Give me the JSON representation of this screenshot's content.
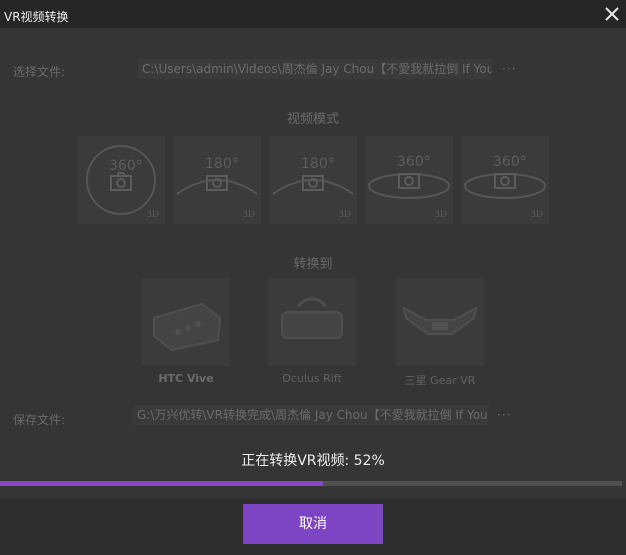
{
  "window": {
    "title": "VR视频转换"
  },
  "source": {
    "label": "选择文件:",
    "path": "C:\\Users\\admin\\Videos\\周杰倫 Jay Chou【不愛我就拉倒 If You D",
    "browse": "···"
  },
  "mode_section": {
    "title": "视频模式",
    "modes": [
      {
        "name": "360-full-3d",
        "degree": "360°",
        "tag": "3D"
      },
      {
        "name": "180-3d",
        "degree": "180°",
        "tag": "3D"
      },
      {
        "name": "180-3d-b",
        "degree": "180°",
        "tag": "3D"
      },
      {
        "name": "360-3d",
        "degree": "360°",
        "tag": "3D"
      },
      {
        "name": "360-3d-b",
        "degree": "360°",
        "tag": "3D"
      }
    ]
  },
  "convert_section": {
    "title": "转换到",
    "devices": [
      {
        "label": "HTC Vive",
        "icon": "htc-vive-headset-icon"
      },
      {
        "label": "Oculus Rift",
        "icon": "oculus-rift-headset-icon"
      },
      {
        "label": "三星 Gear VR",
        "icon": "gear-vr-headset-icon"
      }
    ]
  },
  "output": {
    "label": "保存文件:",
    "path": "G:\\万兴优转\\VR转换完成\\周杰倫 Jay Chou【不愛我就拉倒 If You",
    "browse": "···"
  },
  "progress": {
    "status": "正在转换VR视频: 52%",
    "value": 0.52
  },
  "footer": {
    "cancel_label": "取消"
  },
  "colors": {
    "accent": "#8548c8",
    "button": "#7d45c3",
    "background": "#353535",
    "titlebar": "#262626"
  }
}
